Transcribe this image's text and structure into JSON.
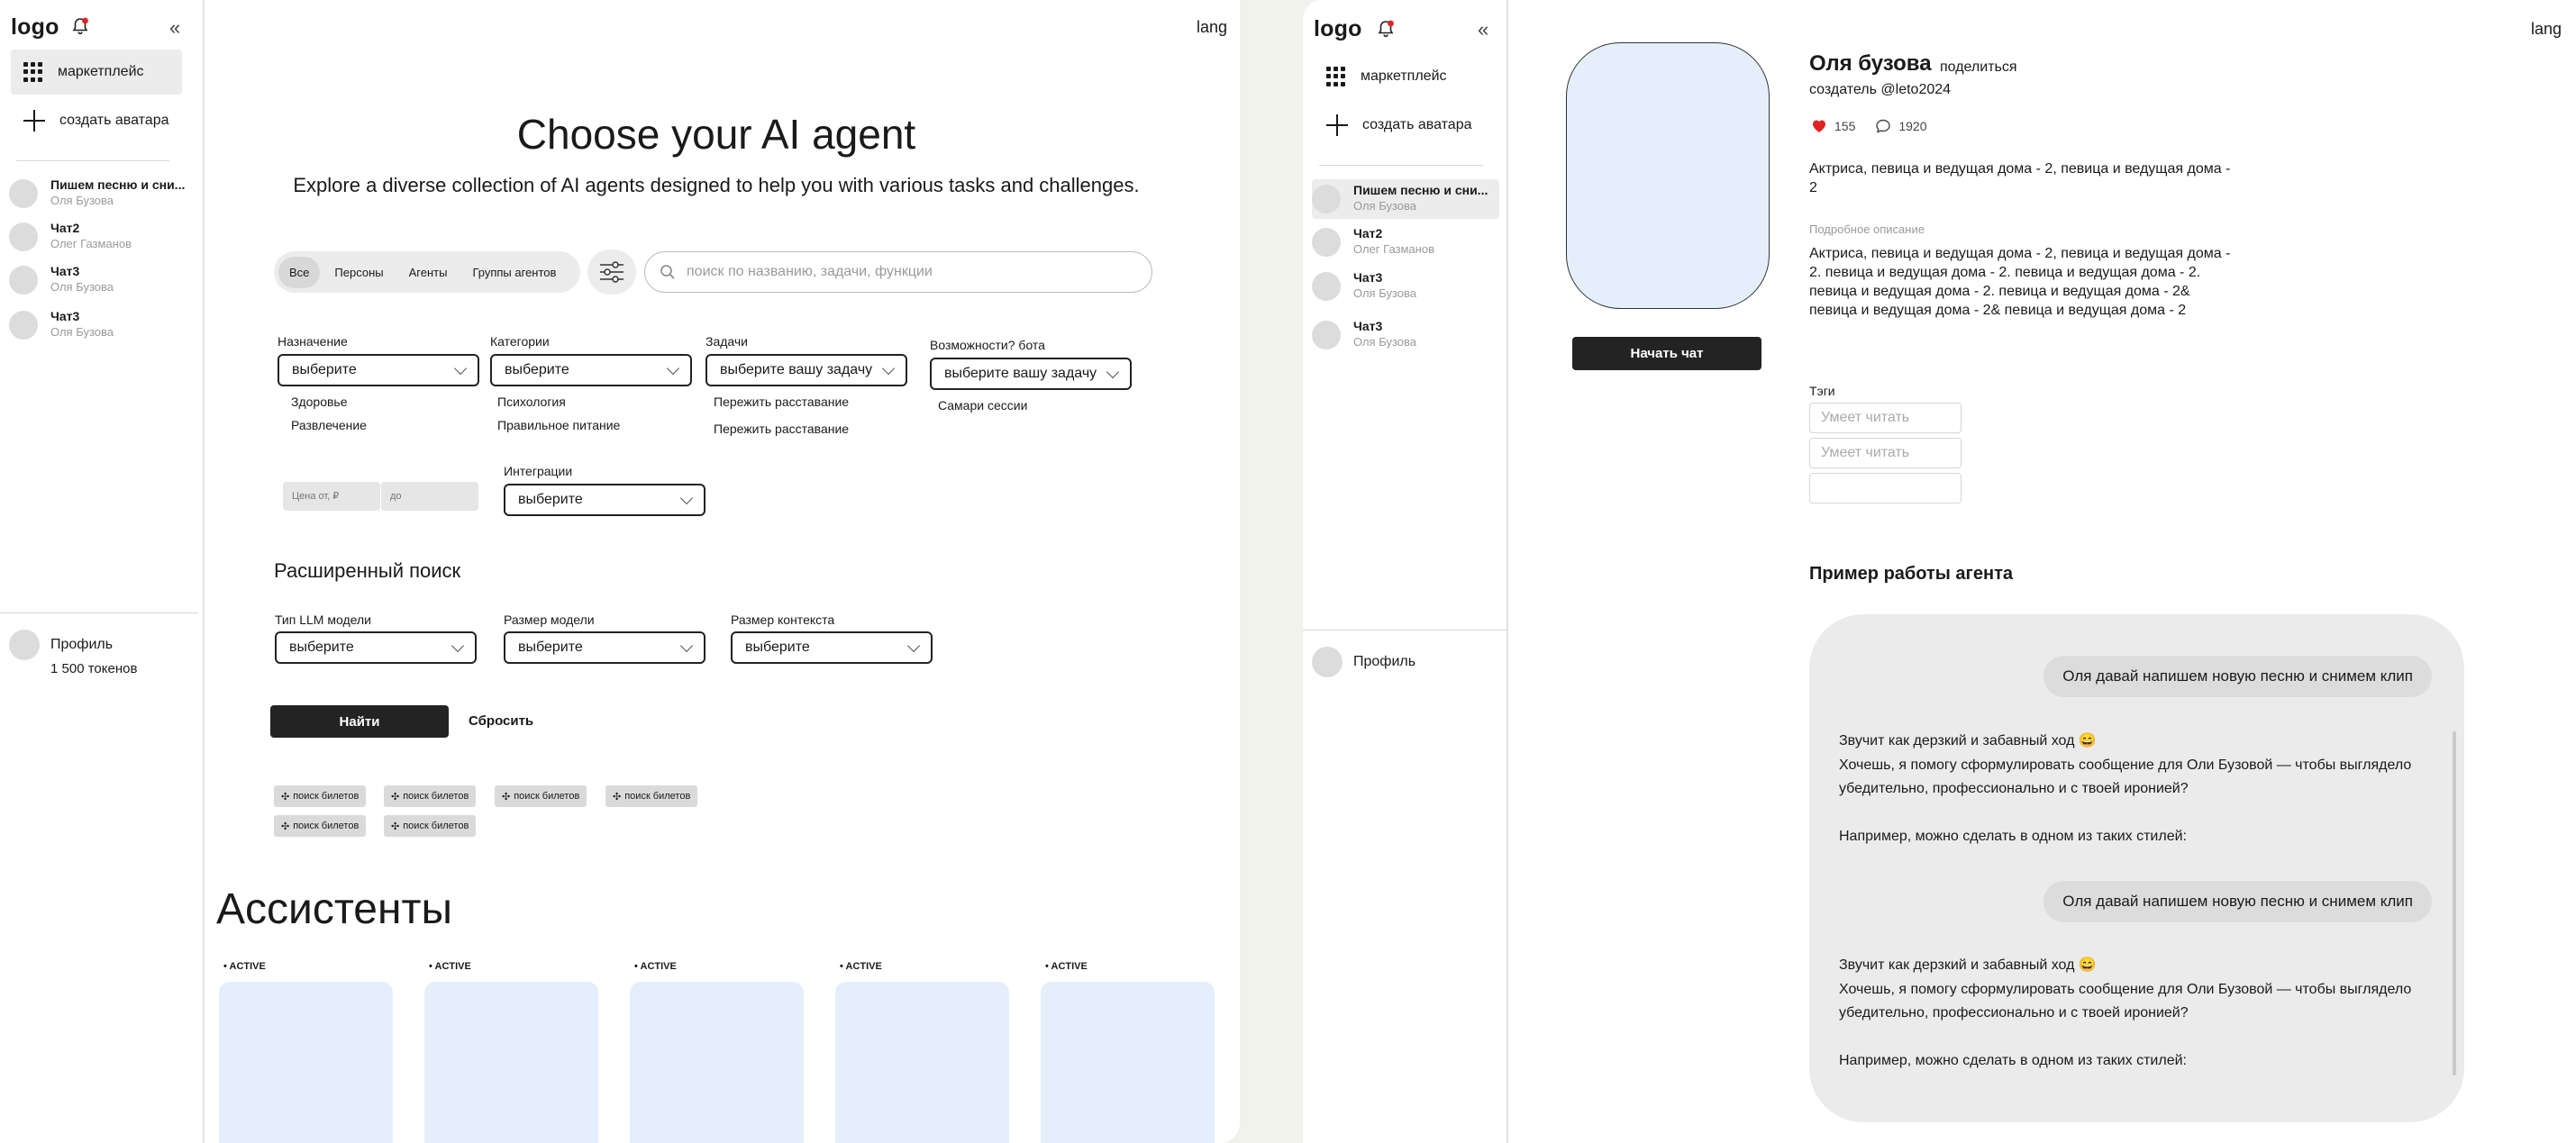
{
  "common": {
    "logo": "logo",
    "marketplace": "маркетплейс",
    "create_avatar": "создать аватара",
    "lang": "lang",
    "profile_name": "Профиль",
    "colors": {
      "accent_dark": "#232323",
      "card_blue": "#e4effb",
      "heart_red": "#e02424"
    }
  },
  "left_sidebar": {
    "chats": [
      {
        "title": "Пишем песню и сни...",
        "subtitle": "Оля Бузова"
      },
      {
        "title": "Чат2",
        "subtitle": "Олег Газманов"
      },
      {
        "title": "Чат3",
        "subtitle": "Оля Бузова"
      },
      {
        "title": "Чат3",
        "subtitle": "Оля Бузова"
      }
    ],
    "tokens": "1 500 токенов"
  },
  "right_sidebar": {
    "chats": [
      {
        "title": "Пишем песню и сни...",
        "subtitle": "Оля Бузова"
      },
      {
        "title": "Чат2",
        "subtitle": "Олег Газманов"
      },
      {
        "title": "Чат3",
        "subtitle": "Оля Бузова"
      },
      {
        "title": "Чат3",
        "subtitle": "Оля Бузова"
      }
    ]
  },
  "catalog": {
    "title": "Choose your AI agent",
    "subtitle": "Explore a diverse collection of AI agents designed to help you with various tasks and challenges.",
    "segments": [
      "Все",
      "Персоны",
      "Агенты",
      "Группы агентов"
    ],
    "selected_segment": "Все",
    "search_placeholder": "поиск по названию, задачи, функции",
    "filters": {
      "purpose": {
        "label": "Назначение",
        "value": "выберите",
        "options": [
          "Здоровье",
          "Развлечение"
        ]
      },
      "categories": {
        "label": "Категории",
        "value": "выберите",
        "options": [
          "Психология",
          "Правильное питание"
        ]
      },
      "tasks": {
        "label": "Задачи",
        "value": "выберите вашу задачу",
        "options": [
          "Пережить расставание",
          "Пережить расставание"
        ]
      },
      "abilities": {
        "label": "Возможности? бота",
        "value": "выберите вашу задачу",
        "options": [
          "Самари сессии"
        ]
      },
      "price_from_placeholder": "Цена от, ₽",
      "price_to_placeholder": "до",
      "integrations": {
        "label": "Интеграции",
        "value": "выберите"
      }
    },
    "advanced": {
      "title": "Расширенный поиск",
      "llm_type": {
        "label": "Тип LLM модели",
        "value": "выберите"
      },
      "model_size": {
        "label": "Размер модели",
        "value": "выберите"
      },
      "context_size": {
        "label": "Размер контекста",
        "value": "выберите"
      }
    },
    "find_button": "Найти",
    "reset_button": "Сбросить",
    "chips": [
      "поиск билетов",
      "поиск билетов",
      "поиск билетов",
      "поиск билетов",
      "поиск билетов",
      "поиск билетов"
    ],
    "assistants_title": "Ассистенты",
    "cards": [
      {
        "badge": "• ACTIVE"
      },
      {
        "badge": "• ACTIVE"
      },
      {
        "badge": "• ACTIVE"
      },
      {
        "badge": "• ACTIVE"
      },
      {
        "badge": "• ACTIVE"
      }
    ]
  },
  "agent": {
    "name": "Оля бузова",
    "share": "поделиться",
    "creator": "создатель @leto2024",
    "likes": "155",
    "comments": "1920",
    "short_desc": "Актриса, певица и ведущая дома - 2, певица и ведущая дома - 2",
    "detail_label": "Подробное описание",
    "detail_desc": "Актриса, певица и ведущая дома - 2, певица и ведущая дома - 2. певица и ведущая дома - 2. певица и ведущая дома - 2. певица и ведущая дома - 2. певица и ведущая дома - 2& певица и ведущая дома - 2& певица и ведущая дома - 2",
    "start_chat": "Начать чат",
    "tags_label": "Тэги",
    "tags": [
      "Умеет читать",
      "Умеет читать",
      ""
    ],
    "example_title": "Пример работы агента",
    "messages": [
      {
        "user": "Оля давай напишем новую песню и снимем клип",
        "reply_1": "Звучит как дерзкий и забавный ход 😄",
        "reply_2": "Хочешь, я помогу сформулировать сообщение для Оли Бузовой — чтобы выглядело убедительно, профессионально и с твоей иронией?",
        "reply_3": "Например, можно сделать в одном из таких стилей:"
      },
      {
        "user": "Оля давай напишем новую песню и снимем клип",
        "reply_1": "Звучит как дерзкий и забавный ход 😄",
        "reply_2": "Хочешь, я помогу сформулировать сообщение для Оли Бузовой — чтобы выглядело убедительно, профессионально и с твоей иронией?",
        "reply_3": "Например, можно сделать в одном из таких стилей:"
      }
    ]
  }
}
